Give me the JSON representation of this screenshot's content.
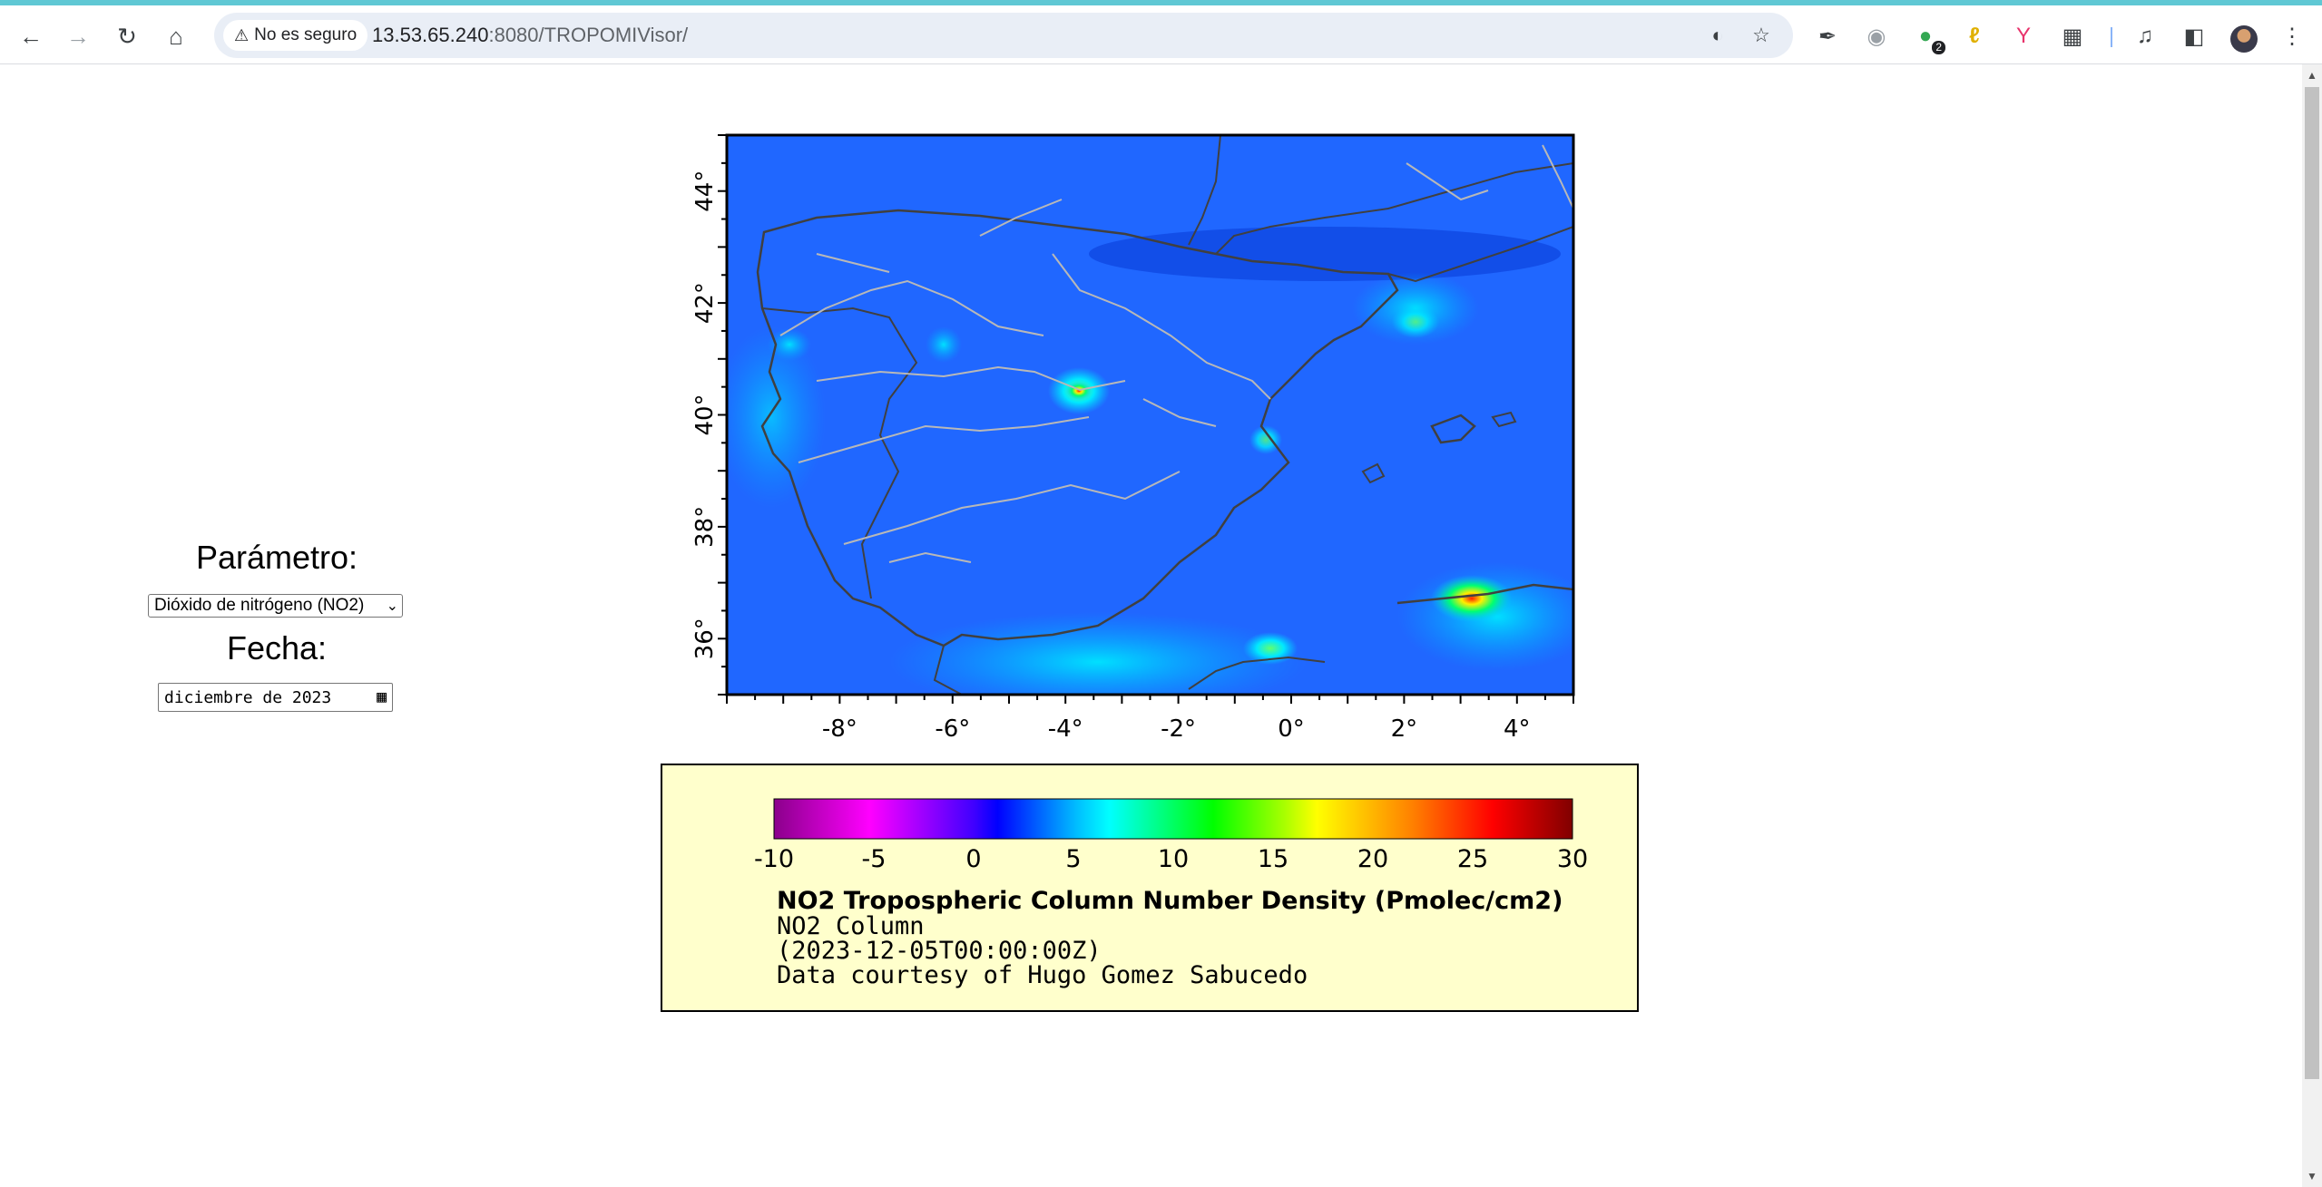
{
  "browser": {
    "security_label": "No es seguro",
    "url_host": "13.53.65.240",
    "url_rest": ":8080/TROPOMIVisor/",
    "extension_badge": "2",
    "icons": [
      "back-icon",
      "forward-icon",
      "reload-icon",
      "home-icon",
      "warning-icon",
      "install-app-icon",
      "star-icon",
      "eyedropper-icon",
      "camera-icon",
      "extension-icon",
      "puzzle-icon",
      "media-icon",
      "side-panel-icon",
      "menu-icon"
    ]
  },
  "form": {
    "parametro_label": "Parámetro:",
    "parametro_value": "Dióxido de nitrógeno (NO2)",
    "fecha_label": "Fecha:",
    "fecha_value": "diciembre de 2023"
  },
  "map": {
    "lat_ticks": [
      "44°",
      "42°",
      "40°",
      "38°",
      "36°"
    ],
    "lon_ticks": [
      "-8°",
      "-6°",
      "-4°",
      "-2°",
      "0°",
      "2°",
      "4°"
    ],
    "lat_range": [
      35,
      45
    ],
    "lon_range": [
      -10,
      5
    ],
    "background_color": "#1b5cff"
  },
  "legend": {
    "ticks": [
      "-10",
      "-5",
      "0",
      "5",
      "10",
      "15",
      "20",
      "25",
      "30"
    ],
    "scale_range": [
      -10,
      30
    ],
    "colors": [
      "#8b008b",
      "#ff00ff",
      "#0000ff",
      "#00bfff",
      "#00ffff",
      "#00ff00",
      "#ffff00",
      "#ff8000",
      "#ff0000",
      "#800000"
    ],
    "title": "NO2 Tropospheric Column Number Density (Pmolec/cm2)",
    "subtitle": "NO2 Column",
    "time": "(2023-12-05T00:00:00Z)",
    "credit": "Data courtesy of Hugo Gomez Sabucedo",
    "background": "#ffffcc"
  }
}
